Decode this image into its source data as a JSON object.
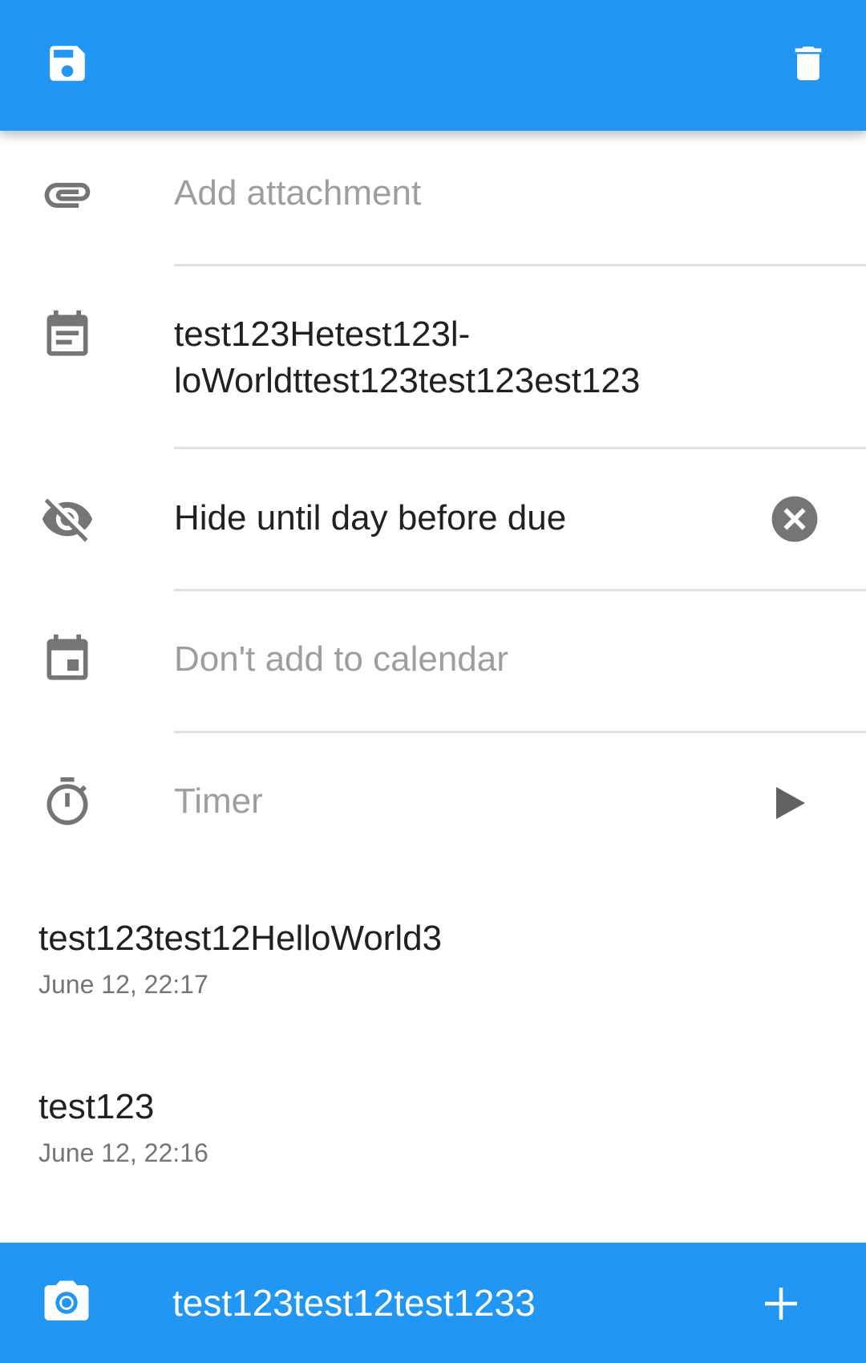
{
  "toolbar": {
    "save_icon": "save-icon",
    "delete_icon": "delete-icon",
    "accent": "#2196F3"
  },
  "rows": {
    "attachment": {
      "hint": "Add attachment"
    },
    "description": {
      "line1": "test123Hetest123l-",
      "line2": "loWorldttest123test123est123"
    },
    "hide": {
      "value": "Hide until day before due"
    },
    "calendar": {
      "hint": "Don't add to calendar"
    },
    "timer": {
      "hint": "Timer"
    }
  },
  "comments": [
    {
      "text": "test123test12HelloWorld3",
      "date": "June 12, 22:17"
    },
    {
      "text": "test123",
      "date": "June 12, 22:16"
    }
  ],
  "bottom": {
    "comment_input": "test123test12test1233"
  }
}
